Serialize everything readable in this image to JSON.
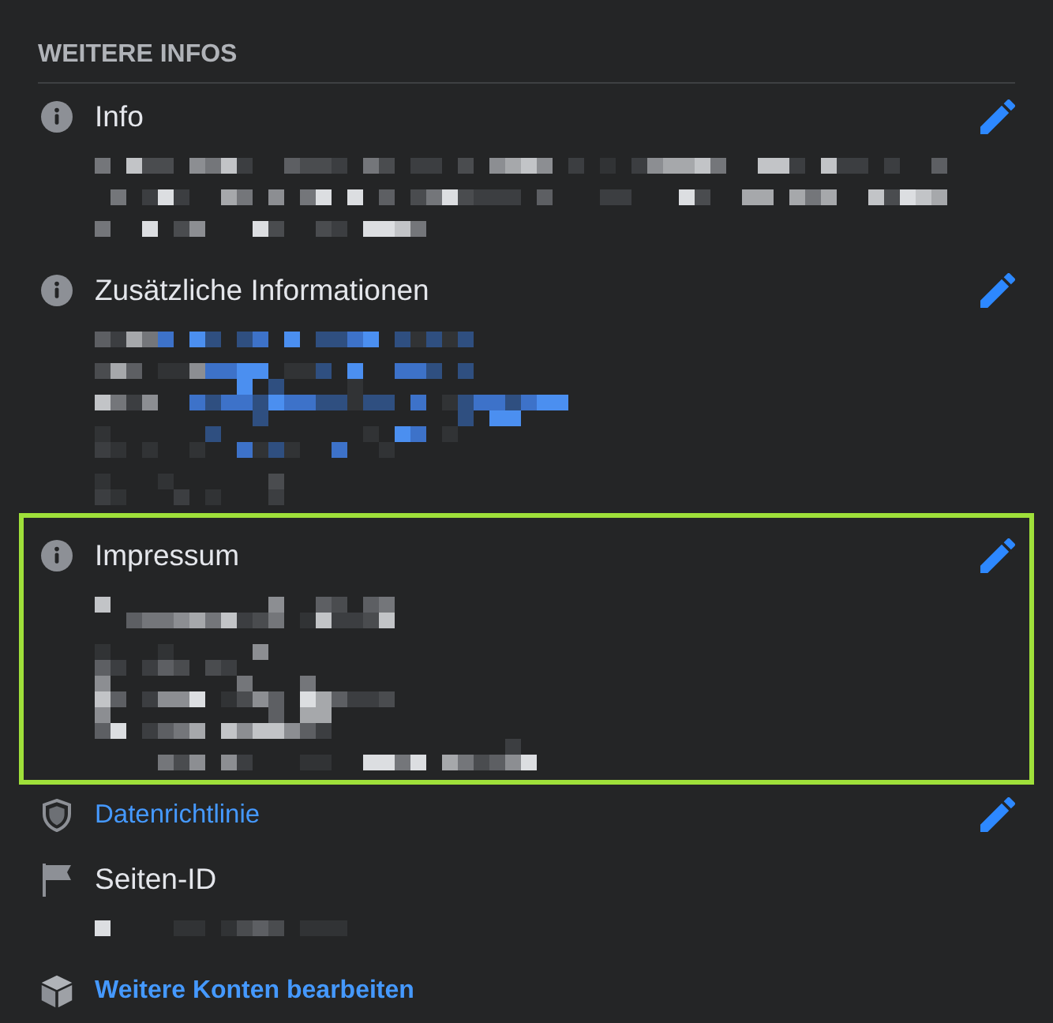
{
  "section": {
    "title": "WEITERE INFOS"
  },
  "items": [
    {
      "kind": "info",
      "label": "Info",
      "editable": true,
      "highlighted": false,
      "redacted": true
    },
    {
      "kind": "info",
      "label": "Zusätzliche Informationen",
      "editable": true,
      "highlighted": false,
      "redacted": true
    },
    {
      "kind": "info",
      "label": "Impressum",
      "editable": true,
      "highlighted": true,
      "redacted": true
    },
    {
      "kind": "policy",
      "label": "Datenrichtlinie",
      "editable": true,
      "highlighted": false,
      "redacted": false
    },
    {
      "kind": "pageid",
      "label": "Seiten-ID",
      "editable": false,
      "highlighted": false,
      "redacted": true
    },
    {
      "kind": "accounts",
      "label": "Weitere Konten bearbeiten",
      "editable": false,
      "highlighted": false,
      "redacted": false
    }
  ]
}
